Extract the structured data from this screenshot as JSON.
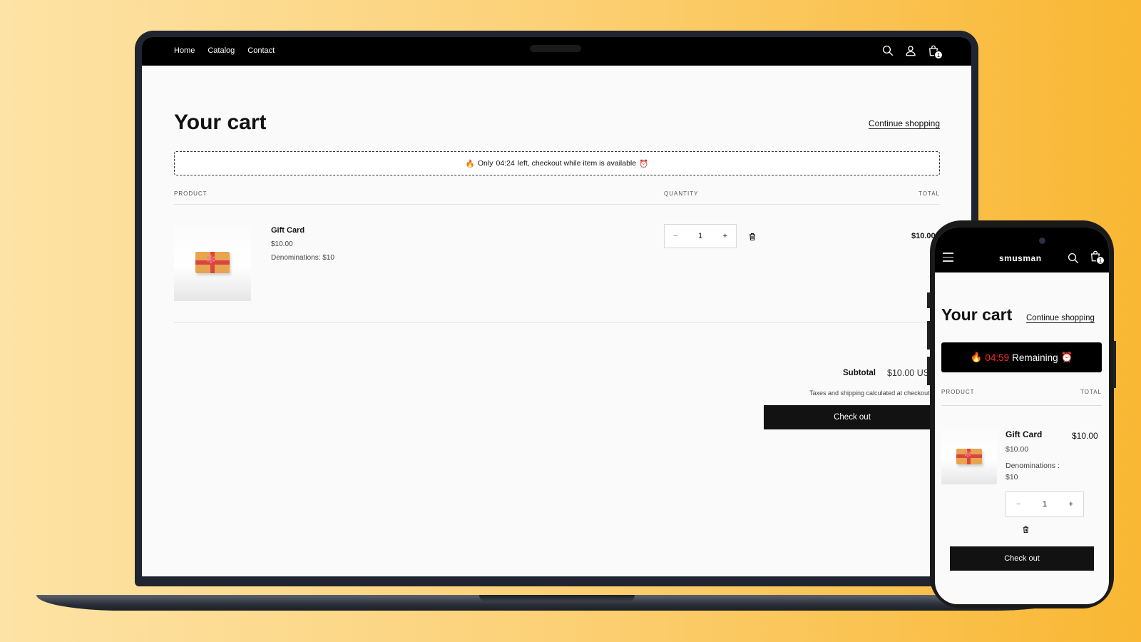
{
  "nav": {
    "items": [
      "Home",
      "Catalog",
      "Contact"
    ]
  },
  "icons": {
    "search": "search-icon",
    "account": "account-icon",
    "cart": "cart-icon",
    "trash": "trash-icon",
    "menu": "hamburger-menu-icon"
  },
  "cart_count": "1",
  "desktop": {
    "title": "Your cart",
    "continue": "Continue shopping",
    "banner": {
      "pre": "Only",
      "time": "04:24",
      "post": "left, checkout while item is available"
    },
    "columns": {
      "product": "PRODUCT",
      "quantity": "QUANTITY",
      "total": "TOTAL"
    },
    "item": {
      "name": "Gift Card",
      "price": "$10.00",
      "denomination": "Denominations: $10",
      "quantity": "1",
      "qty_minus": "−",
      "qty_plus": "+",
      "total": "$10.00"
    },
    "subtotal_label": "Subtotal",
    "subtotal_value": "$10.00 USD",
    "tax_note": "Taxes and shipping calculated at checkout",
    "checkout": "Check out"
  },
  "mobile": {
    "logo": "smusman",
    "title": "Your cart",
    "continue": "Continue shopping",
    "banner": {
      "time": "04:59",
      "post": "Remaining"
    },
    "columns": {
      "product": "PRODUCT",
      "total": "TOTAL"
    },
    "item": {
      "name": "Gift Card",
      "price": "$10.00",
      "denomination": "Denominations : $10",
      "quantity": "1",
      "qty_minus": "−",
      "qty_plus": "+",
      "total": "$10.00"
    },
    "checkout": "Check out"
  },
  "colors": {
    "background_start": "#fde3a6",
    "background_end": "#f9b733",
    "header": "#000000",
    "button": "#121212",
    "timer_red": "#ff2a2a"
  }
}
